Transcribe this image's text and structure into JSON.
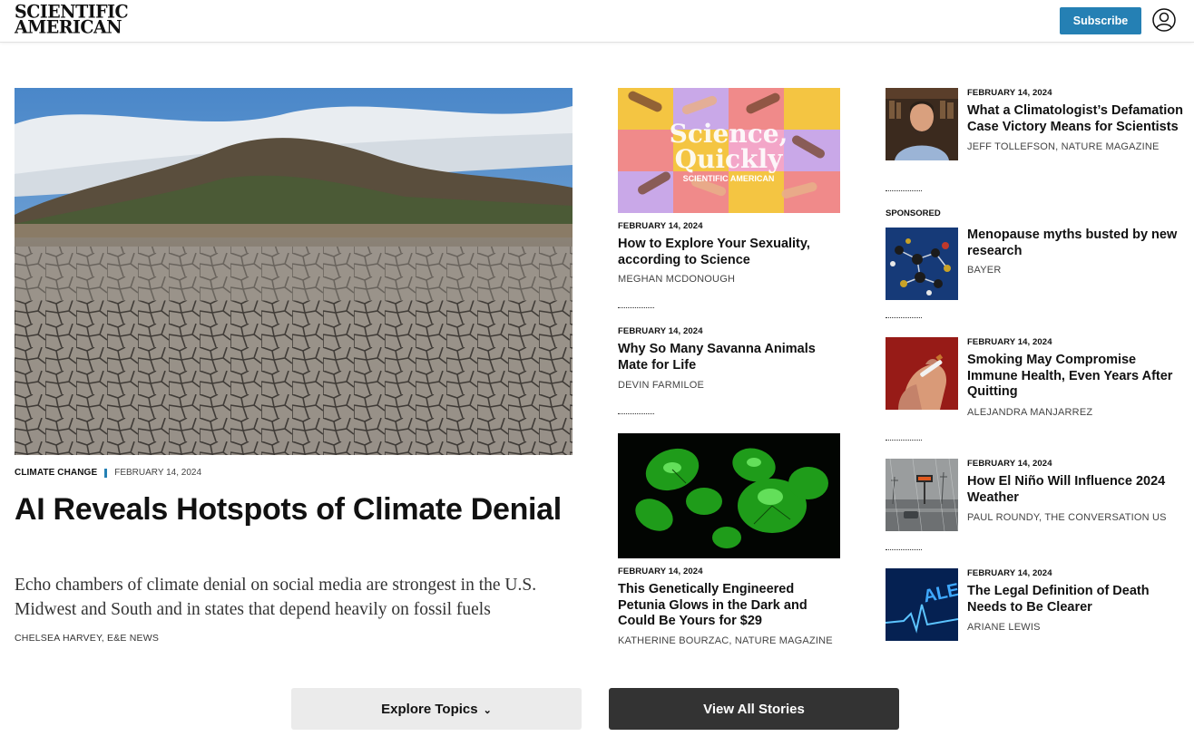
{
  "header": {
    "logo_line1": "SCIENTIFIC",
    "logo_line2": "AMERICAN",
    "subscribe_label": "Subscribe",
    "accent_color": "#2580b4"
  },
  "hero": {
    "category": "CLIMATE CHANGE",
    "date": "FEBRUARY 14, 2024",
    "title": "AI Reveals Hotspots of Climate Denial",
    "dek": "Echo chambers of climate denial on social media are strongest in the U.S. Midwest and South and in states that depend heavily on fossil fuels",
    "byline": "CHELSEA HARVEY, E&E NEWS",
    "image_icon": "dry-lakebed-photo"
  },
  "middle": [
    {
      "image_text_1": "Science,",
      "image_text_2": "Quickly",
      "image_text_3": "SCIENTIFIC AMERICAN",
      "date": "FEBRUARY 14, 2024",
      "title": "How to Explore Your Sexuality, according to Science",
      "byline": "MEGHAN MCDONOUGH"
    },
    {
      "date": "FEBRUARY 14, 2024",
      "title": "Why So Many Savanna Animals Mate for Life",
      "byline": "DEVIN FARMILOE"
    },
    {
      "date": "FEBRUARY 14, 2024",
      "title": "This Genetically Engineered Petunia Glows in the Dark and Could Be Yours for $29",
      "byline": "KATHERINE BOURZAC, NATURE MAGAZINE"
    }
  ],
  "right": [
    {
      "date": "FEBRUARY 14, 2024",
      "title": "What a Climatologist’s Defamation Case Victory Means for Scientists",
      "byline": "JEFF TOLLEFSON, NATURE MAGAZINE"
    },
    {
      "label": "SPONSORED",
      "title": "Menopause myths busted by new research",
      "byline": "BAYER"
    },
    {
      "date": "FEBRUARY 14, 2024",
      "title": "Smoking May Compromise Immune Health, Even Years After Quitting",
      "byline": "ALEJANDRA MANJARREZ"
    },
    {
      "date": "FEBRUARY 14, 2024",
      "title": "How El Niño Will Influence 2024 Weather",
      "byline": "PAUL ROUNDY, THE CONVERSATION US"
    },
    {
      "date": "FEBRUARY 14, 2024",
      "title": "The Legal Definition of Death Needs to Be Clearer",
      "byline": "ARIANE LEWIS",
      "image_text": "ALE"
    }
  ],
  "buttons": {
    "explore_label": "Explore Topics",
    "explore_icon": "chevron-down-icon",
    "view_all_label": "View All Stories"
  }
}
